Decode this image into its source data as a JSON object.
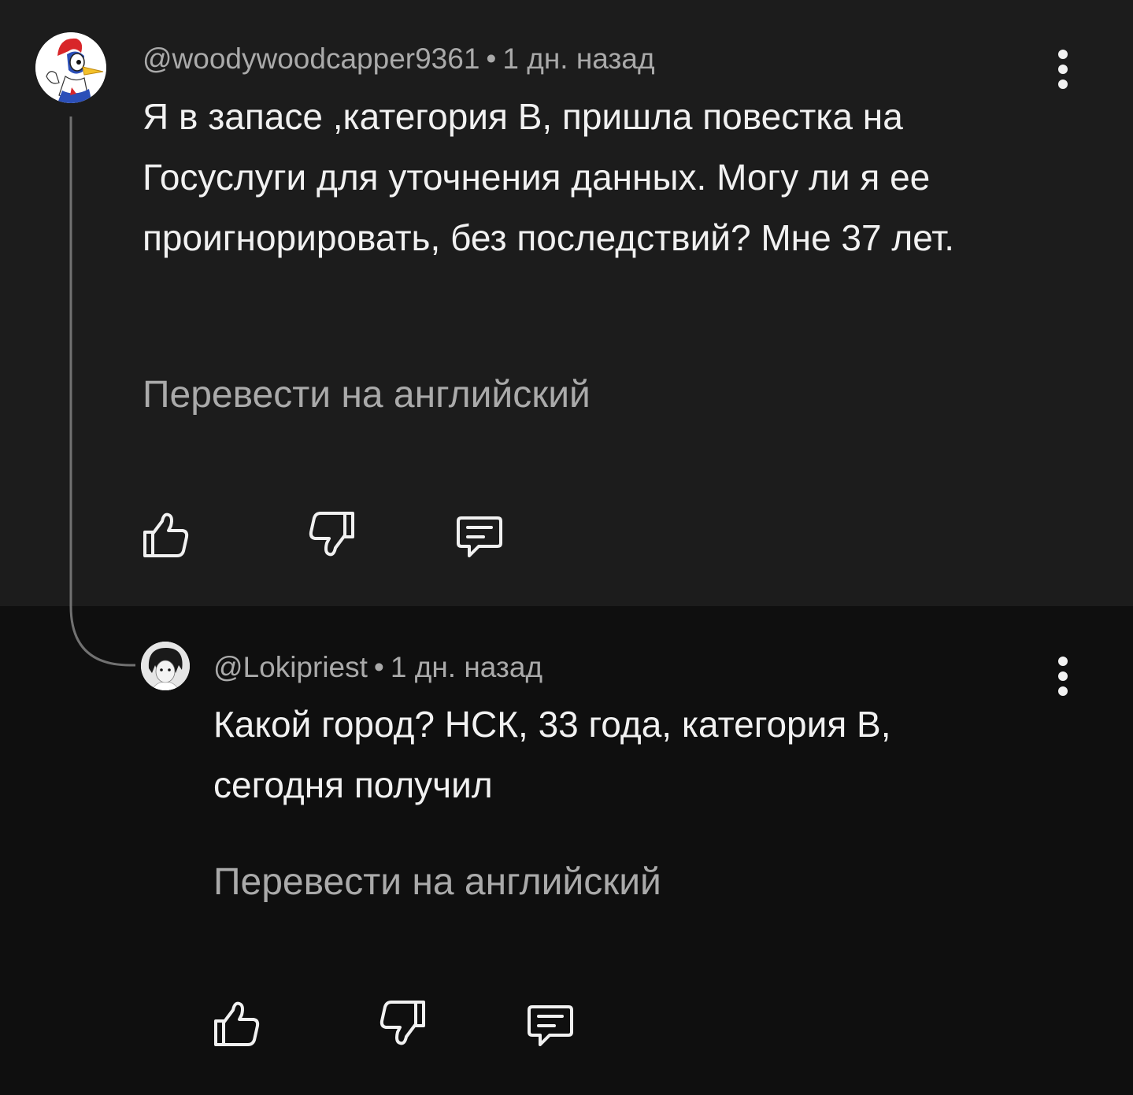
{
  "comments": [
    {
      "author": "@woodywoodcapper9361",
      "separator": "•",
      "time": "1 дн. назад",
      "text": "Я в запасе ,категория В, пришла повестка на Госуслуги для уточнения данных. Могу ли я ее проигнорировать, без последствий? Мне 37 лет.",
      "translate_label": "Перевести на английский",
      "avatar_icon": "woody-woodpecker-avatar",
      "actions": [
        "thumbs-up-icon",
        "thumbs-down-icon",
        "reply-icon"
      ]
    },
    {
      "author": "@Lokipriest",
      "separator": "•",
      "time": "1 дн. назад",
      "text": "Какой город? НСК, 33 года, категория В, сегодня получил",
      "translate_label": "Перевести на английский",
      "avatar_icon": "anime-character-avatar",
      "actions": [
        "thumbs-up-icon",
        "thumbs-down-icon",
        "reply-icon"
      ]
    }
  ],
  "colors": {
    "top_background": "#1c1c1c",
    "bottom_background": "#0f0f0f",
    "primary_text": "#f1f1f1",
    "secondary_text": "#aaaaaa",
    "thread_line": "#717171"
  }
}
